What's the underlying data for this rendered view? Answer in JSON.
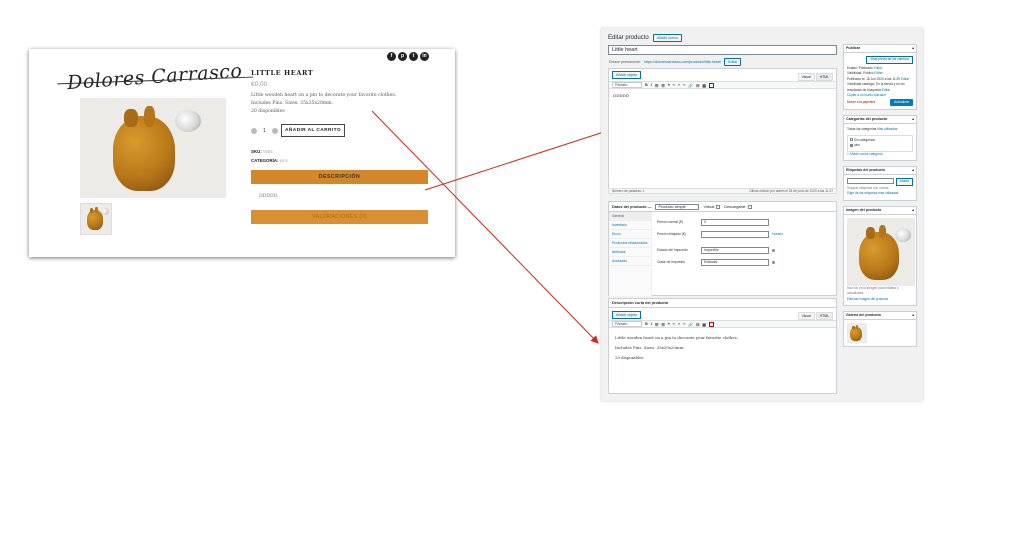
{
  "store": {
    "logo": "Dolores Carrasco",
    "socials": [
      "f",
      "p",
      "t",
      "in"
    ],
    "product_title": "LITTLE HEART",
    "price": "€0,00",
    "description_lines": [
      "Little wooden heart on a pin to decorate your favorite clothes.",
      "Includes Pins. Sizes: 35x35x20mm.",
      "20 disponibles"
    ],
    "quantity": "1",
    "add_to_cart": "AÑADIR AL CARRITO",
    "sku_label": "SKU:",
    "sku_value": "0585",
    "category_label": "CATEGORÍA:",
    "category_value": "pins",
    "tab_description": "DESCRIPCIÓN",
    "tab_content": "DDDDD",
    "tab_reviews": "VALORACIONES (0)"
  },
  "admin": {
    "page_title": "Editar producto",
    "add_new": "Añadir nuevo",
    "product_name": "Little heart",
    "permalink_label": "Enlace permanente:",
    "permalink_url": "https://dolorescarrasco.com/producto/little-heart/",
    "permalink_edit": "Editar",
    "add_media": "Añadir objeto",
    "tab_visual": "Visual",
    "tab_html": "HTML",
    "format_select": "Párrafo",
    "toolbar_glyphs": [
      "B",
      "I",
      "☰",
      "☰",
      "❝",
      "≡",
      "≡",
      "≡",
      "🔗",
      "⊟",
      "▦"
    ],
    "editor_content": "DDDDD",
    "word_count": "Número de palabras: 1",
    "last_edited": "Última edición por admin el 18 de junio de 2020 a las 11:27",
    "product_data_label": "Datos del producto —",
    "product_type": "Producto simple",
    "virtual_label": "Virtual:",
    "downloadable_label": "Descargable:",
    "pd_tabs": [
      "General",
      "Inventario",
      "Envío",
      "Productos relacionados",
      "Atributos",
      "Avanzado"
    ],
    "regular_price_label": "Precio normal (€)",
    "regular_price_value": "0",
    "sale_price_label": "Precio rebajado (€)",
    "schedule_link": "Horario",
    "tax_status_label": "Estado del impuesto",
    "tax_status_value": "Imponible",
    "tax_class_label": "Clase de impuesto",
    "tax_class_value": "Estándar",
    "short_desc_title": "Descripción corta del producto",
    "short_desc_lines": [
      "Little wooden heart on a pin to decorate your favorite clothes.",
      "Includes Pins. Sizes: 35x35x20mm.",
      "20 disponibles"
    ],
    "publish": {
      "title": "Publicar",
      "preview_changes": "Vista previa de los cambios",
      "status": "Estado: Publicado",
      "visibility": "Visibilidad: Público",
      "published_on": "Publicado el: 18 Jun 2020 a las 11:29",
      "catalog_visibility": "Visibilidad catálogo: En la tienda y en los resultados de búsqueda",
      "edit": "Editar",
      "copy_draft": "Copiar a un nuevo borrador",
      "trash": "Mover a la papelera",
      "update": "Actualizar"
    },
    "categories": {
      "title": "Categorías del producto",
      "tab_all": "Todas las categorías",
      "tab_used": "Más utilizadas",
      "items": [
        "Sin categorizar",
        "pins"
      ],
      "add_new": "+ Añadir nueva categoría"
    },
    "tags": {
      "title": "Etiquetas del producto",
      "add": "Añadir",
      "hint": "Separar etiquetas con comas",
      "choose": "Elige de las etiquetas más utilizadas"
    },
    "product_image": {
      "title": "Imagen del producto",
      "hint": "Haz clic en la imagen para editarla o actualizarla",
      "remove": "Eliminar imagen del producto"
    },
    "gallery": {
      "title": "Galería del producto"
    }
  }
}
